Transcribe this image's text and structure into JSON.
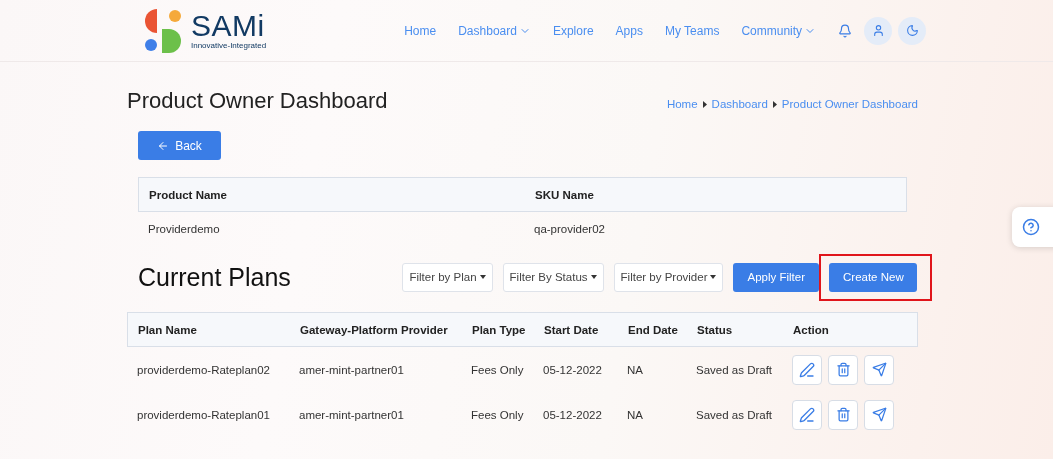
{
  "logo": {
    "name": "SAMi",
    "tagline": "Innovative-Integrated"
  },
  "nav": [
    {
      "label": "Home",
      "kind": "link"
    },
    {
      "label": "Dashboard",
      "kind": "dropdown"
    },
    {
      "label": "Explore",
      "kind": "link"
    },
    {
      "label": "Apps",
      "kind": "link"
    },
    {
      "label": "My Teams",
      "kind": "link"
    },
    {
      "label": "Community",
      "kind": "dropdown"
    }
  ],
  "page_title": "Product Owner Dashboard",
  "breadcrumb": [
    "Home",
    "Dashboard",
    "Product Owner Dashboard"
  ],
  "back_button": "Back",
  "product_table": {
    "columns": [
      "Product Name",
      "SKU Name"
    ],
    "rows": [
      [
        "Providerdemo",
        "qa-provider02"
      ]
    ]
  },
  "plans": {
    "title": "Current Plans",
    "filters": [
      "Filter by Plan",
      "Filter By Status",
      "Filter by Provider"
    ],
    "apply_button": "Apply Filter",
    "create_button": {
      "label": "Create New",
      "highlighted": true
    },
    "columns": [
      "Plan Name",
      "Gateway-Platform Provider",
      "Plan Type",
      "Start Date",
      "End Date",
      "Status",
      "Action"
    ],
    "rows": [
      [
        "providerdemo-Rateplan02",
        "amer-mint-partner01",
        "Fees Only",
        "05-12-2022",
        "NA",
        "Saved as Draft"
      ],
      [
        "providerdemo-Rateplan01",
        "amer-mint-partner01",
        "Fees Only",
        "05-12-2022",
        "NA",
        "Saved as Draft"
      ]
    ]
  }
}
